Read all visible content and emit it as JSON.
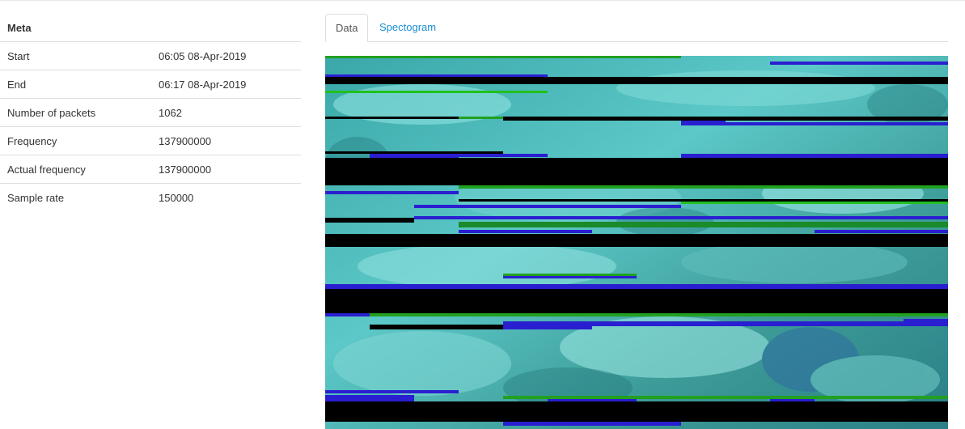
{
  "meta": {
    "title": "Meta",
    "rows": [
      {
        "label": "Start",
        "value": "06:05 08-Apr-2019"
      },
      {
        "label": "End",
        "value": "06:17 08-Apr-2019"
      },
      {
        "label": "Number of packets",
        "value": "1062"
      },
      {
        "label": "Frequency",
        "value": "137900000"
      },
      {
        "label": "Actual frequency",
        "value": "137900000"
      },
      {
        "label": "Sample rate",
        "value": "150000"
      }
    ]
  },
  "tabs": [
    {
      "label": "Data",
      "active": true
    },
    {
      "label": "Spectogram",
      "active": false
    }
  ],
  "colors": {
    "link": "#1a8fd1",
    "cloud_cyan": "#4fc4c4",
    "sea_teal": "#2f8f8a",
    "noise_blue": "#2a1fd0",
    "noise_green": "#22c020",
    "gap_black": "#000000"
  }
}
